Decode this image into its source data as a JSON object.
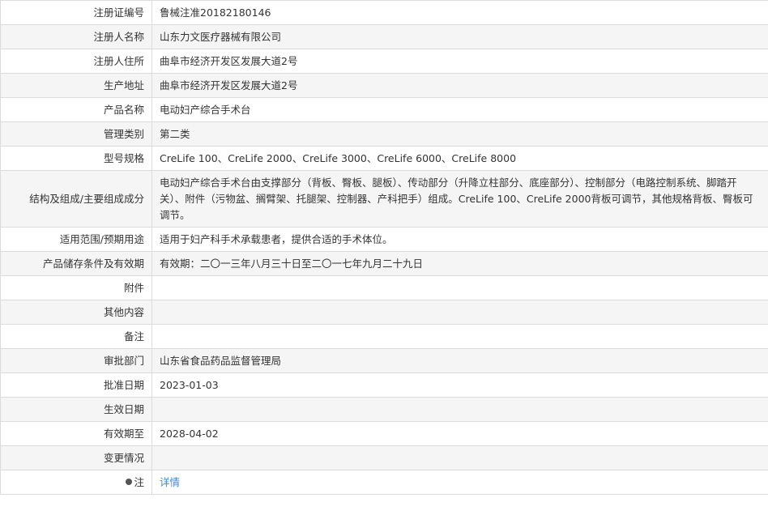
{
  "rows": {
    "reg_no": {
      "label": "注册证编号",
      "value": "鲁械注准20182180146"
    },
    "registrant": {
      "label": "注册人名称",
      "value": "山东力文医疗器械有限公司"
    },
    "address": {
      "label": "注册人住所",
      "value": "曲阜市经济开发区发展大道2号"
    },
    "prod_site": {
      "label": "生产地址",
      "value": "曲阜市经济开发区发展大道2号"
    },
    "product": {
      "label": "产品名称",
      "value": "电动妇产综合手术台"
    },
    "category": {
      "label": "管理类别",
      "value": "第二类"
    },
    "models": {
      "label": "型号规格",
      "value": "CreLife 100、CreLife 2000、CreLife 3000、CreLife 6000、CreLife 8000"
    },
    "composition": {
      "label": "结构及组成/主要组成成分",
      "value": "电动妇产综合手术台由支撑部分（背板、臀板、腿板）、传动部分（升降立柱部分、底座部分）、控制部分（电路控制系统、脚踏开关）、附件（污物盆、搁臂架、托腿架、控制器、产科把手）组成。CreLife 100、CreLife 2000背板可调节，其他规格背板、臀板可调节。"
    },
    "usage": {
      "label": "适用范围/预期用途",
      "value": "适用于妇产科手术承载患者，提供合适的手术体位。"
    },
    "storage": {
      "label": "产品储存条件及有效期",
      "value": "有效期：二〇一三年八月三十日至二〇一七年九月二十九日"
    },
    "attachment": {
      "label": "附件",
      "value": ""
    },
    "other": {
      "label": "其他内容",
      "value": ""
    },
    "remark": {
      "label": "备注",
      "value": ""
    },
    "approver": {
      "label": "审批部门",
      "value": "山东省食品药品监督管理局"
    },
    "approve_date": {
      "label": "批准日期",
      "value": "2023-01-03"
    },
    "effective_date": {
      "label": "生效日期",
      "value": ""
    },
    "valid_until": {
      "label": "有效期至",
      "value": "2028-04-02"
    },
    "changes": {
      "label": "变更情况",
      "value": ""
    },
    "note": {
      "label": "注",
      "icon": "note-dot-icon",
      "link_text": "详情",
      "link_color": "#3a8ad8"
    }
  }
}
